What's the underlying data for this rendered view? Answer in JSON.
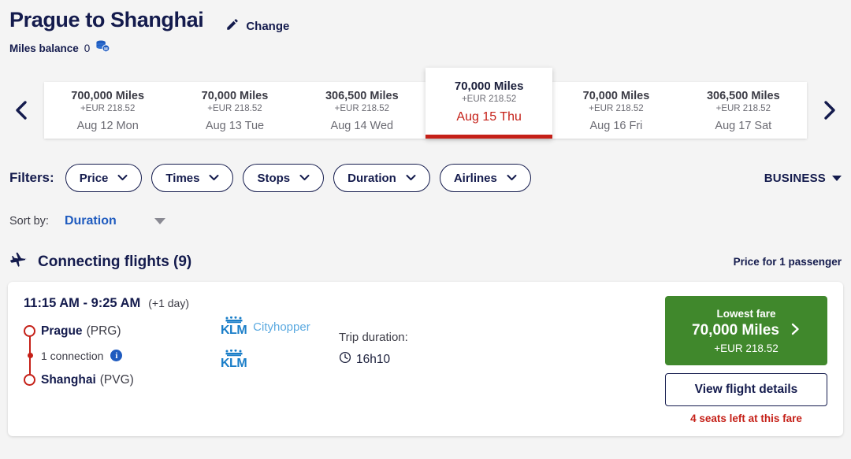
{
  "header": {
    "title": "Prague to Shanghai",
    "change_label": "Change",
    "change_icon": "pencil-icon",
    "miles_label": "Miles balance",
    "miles_value": "0",
    "miles_icon": "coins-icon"
  },
  "carousel": {
    "prev_icon": "chevron-left-icon",
    "next_icon": "chevron-right-icon",
    "dates": [
      {
        "miles": "700,000 Miles",
        "eur": "+EUR 218.52",
        "day": "Aug 12 Mon",
        "selected": false
      },
      {
        "miles": "70,000 Miles",
        "eur": "+EUR 218.52",
        "day": "Aug 13 Tue",
        "selected": false
      },
      {
        "miles": "306,500 Miles",
        "eur": "+EUR 218.52",
        "day": "Aug 14 Wed",
        "selected": false
      },
      {
        "miles": "70,000 Miles",
        "eur": "+EUR 218.52",
        "day": "Aug 15 Thu",
        "selected": true
      },
      {
        "miles": "70,000 Miles",
        "eur": "+EUR 218.52",
        "day": "Aug 16 Fri",
        "selected": false
      },
      {
        "miles": "306,500 Miles",
        "eur": "+EUR 218.52",
        "day": "Aug 17 Sat",
        "selected": false
      }
    ]
  },
  "filters": {
    "label": "Filters:",
    "items": [
      {
        "label": "Price"
      },
      {
        "label": "Times"
      },
      {
        "label": "Stops"
      },
      {
        "label": "Duration"
      },
      {
        "label": "Airlines"
      }
    ],
    "cabin_class": "BUSINESS"
  },
  "sort": {
    "label": "Sort by:",
    "value": "Duration"
  },
  "results": {
    "icon": "airplane-icon",
    "title": "Connecting flights (9)",
    "price_note": "Price for 1 passenger"
  },
  "flight": {
    "times": "11:15 AM - 9:25 AM",
    "day_offset": "(+1 day)",
    "origin_city": "Prague",
    "origin_code": "(PRG)",
    "connection_text": "1 connection",
    "connection_info_icon": "info-icon",
    "destination_city": "Shanghai",
    "destination_code": "(PVG)",
    "airlines": [
      {
        "name": "KLM",
        "sub": "Cityhopper"
      },
      {
        "name": "KLM",
        "sub": ""
      }
    ],
    "duration_label": "Trip duration:",
    "duration_icon": "clock-icon",
    "duration_value": "16h10",
    "fare_top": "Lowest fare",
    "fare_miles": "70,000 Miles",
    "fare_eur": "+EUR 218.52",
    "fare_arrow_icon": "chevron-right-icon",
    "details_label": "View flight details",
    "seats_left": "4 seats left at this fare"
  },
  "colors": {
    "brand_navy": "#141b4d",
    "accent_red": "#c52018",
    "fare_green": "#40882c",
    "link_blue": "#1f5bbf",
    "klm_blue": "#1a7ec8",
    "page_bg": "#f4f4f4"
  }
}
